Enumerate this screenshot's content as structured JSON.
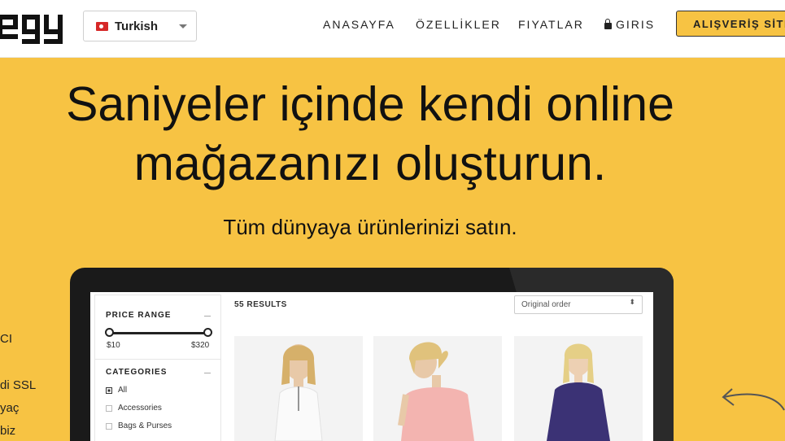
{
  "header": {
    "lang_label": "Turkish",
    "nav": [
      "ANASAYFA",
      "ÖZELLİKLER",
      "FIYATLAR",
      "GIRIS"
    ],
    "cta_label": "ALIŞVERİŞ SİTESİ"
  },
  "hero": {
    "headline_line1": "Saniyeler içinde kendi online",
    "headline_line2": "mağazanızı oluşturun.",
    "subline": "Tüm dünyaya ürünlerinizi satın."
  },
  "side_snippets": [
    "CI",
    "di SSL",
    "yaç",
    "biz"
  ],
  "store": {
    "results": "55 RESULTS",
    "sort_value": "Original order",
    "sort_arrows": "⬍",
    "price_title": "PRICE RANGE",
    "price_min": "$10",
    "price_max": "$320",
    "categories_title": "CATEGORIES",
    "categories": [
      "All",
      "Accessories",
      "Bags & Purses"
    ],
    "selected_category": "All"
  },
  "colors": {
    "brand_yellow": "#f7c343",
    "dark": "#1a1a1a"
  },
  "icons": [
    "turkey-flag-icon",
    "chevron-down-icon",
    "lock-icon",
    "curved-arrow-icon"
  ]
}
